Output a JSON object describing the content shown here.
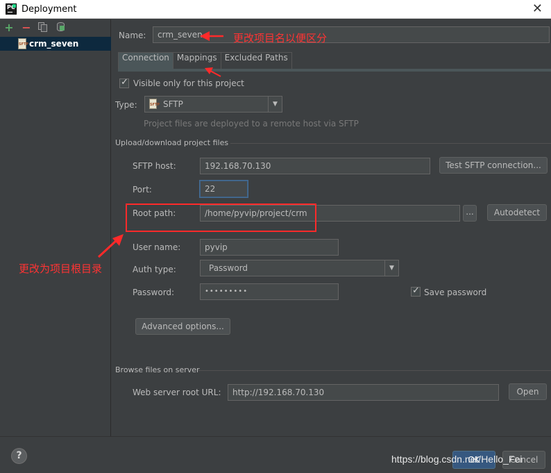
{
  "window": {
    "title": "Deployment",
    "close_glyph": "✕"
  },
  "toolbar": {
    "add_glyph": "+",
    "remove_glyph": "−",
    "icons": [
      "add-icon",
      "remove-icon",
      "copy-icon",
      "default-server-icon"
    ]
  },
  "tree": {
    "items": [
      {
        "label": "crm_seven",
        "icon": "sftp-icon",
        "icon_text": "SFTP"
      }
    ]
  },
  "name": {
    "label": "Name:",
    "value": "crm_seven"
  },
  "tabs": [
    {
      "label": "Connection"
    },
    {
      "label": "Mappings"
    },
    {
      "label": "Excluded Paths"
    }
  ],
  "connection": {
    "visible_only": {
      "label": "Visible only for this project",
      "checked": true
    },
    "type": {
      "label": "Type:",
      "value": "SFTP",
      "hint": "Project files are deployed to a remote host via SFTP"
    },
    "upload_section": "Upload/download project files",
    "sftp_host": {
      "label": "SFTP host:",
      "value": "192.168.70.130"
    },
    "test_button": "Test SFTP connection...",
    "port": {
      "label": "Port:",
      "value": "22"
    },
    "root_path": {
      "label": "Root path:",
      "value": "/home/pyvip/project/crm"
    },
    "browse_button": "...",
    "autodetect_button": "Autodetect",
    "user_name": {
      "label": "User name:",
      "value": "pyvip"
    },
    "auth_type": {
      "label": "Auth type:",
      "value": "Password"
    },
    "password": {
      "label": "Password:",
      "value": "•••••••••"
    },
    "save_password": {
      "label": "Save password",
      "checked": true
    },
    "advanced_button": "Advanced options...",
    "browse_section": "Browse files on server",
    "web_root_url": {
      "label": "Web server root URL:",
      "value": "http://192.168.70.130"
    },
    "open_button": "Open"
  },
  "footer": {
    "help_glyph": "?",
    "ok_button": "OK",
    "cancel_button": "Cancel"
  },
  "annotations": {
    "rename": "更改项目名以便区分",
    "root_path": "更改为项目根目录",
    "color": "#ff2a2a"
  },
  "watermark": "https://blog.csdn.net/Hello_Fei"
}
